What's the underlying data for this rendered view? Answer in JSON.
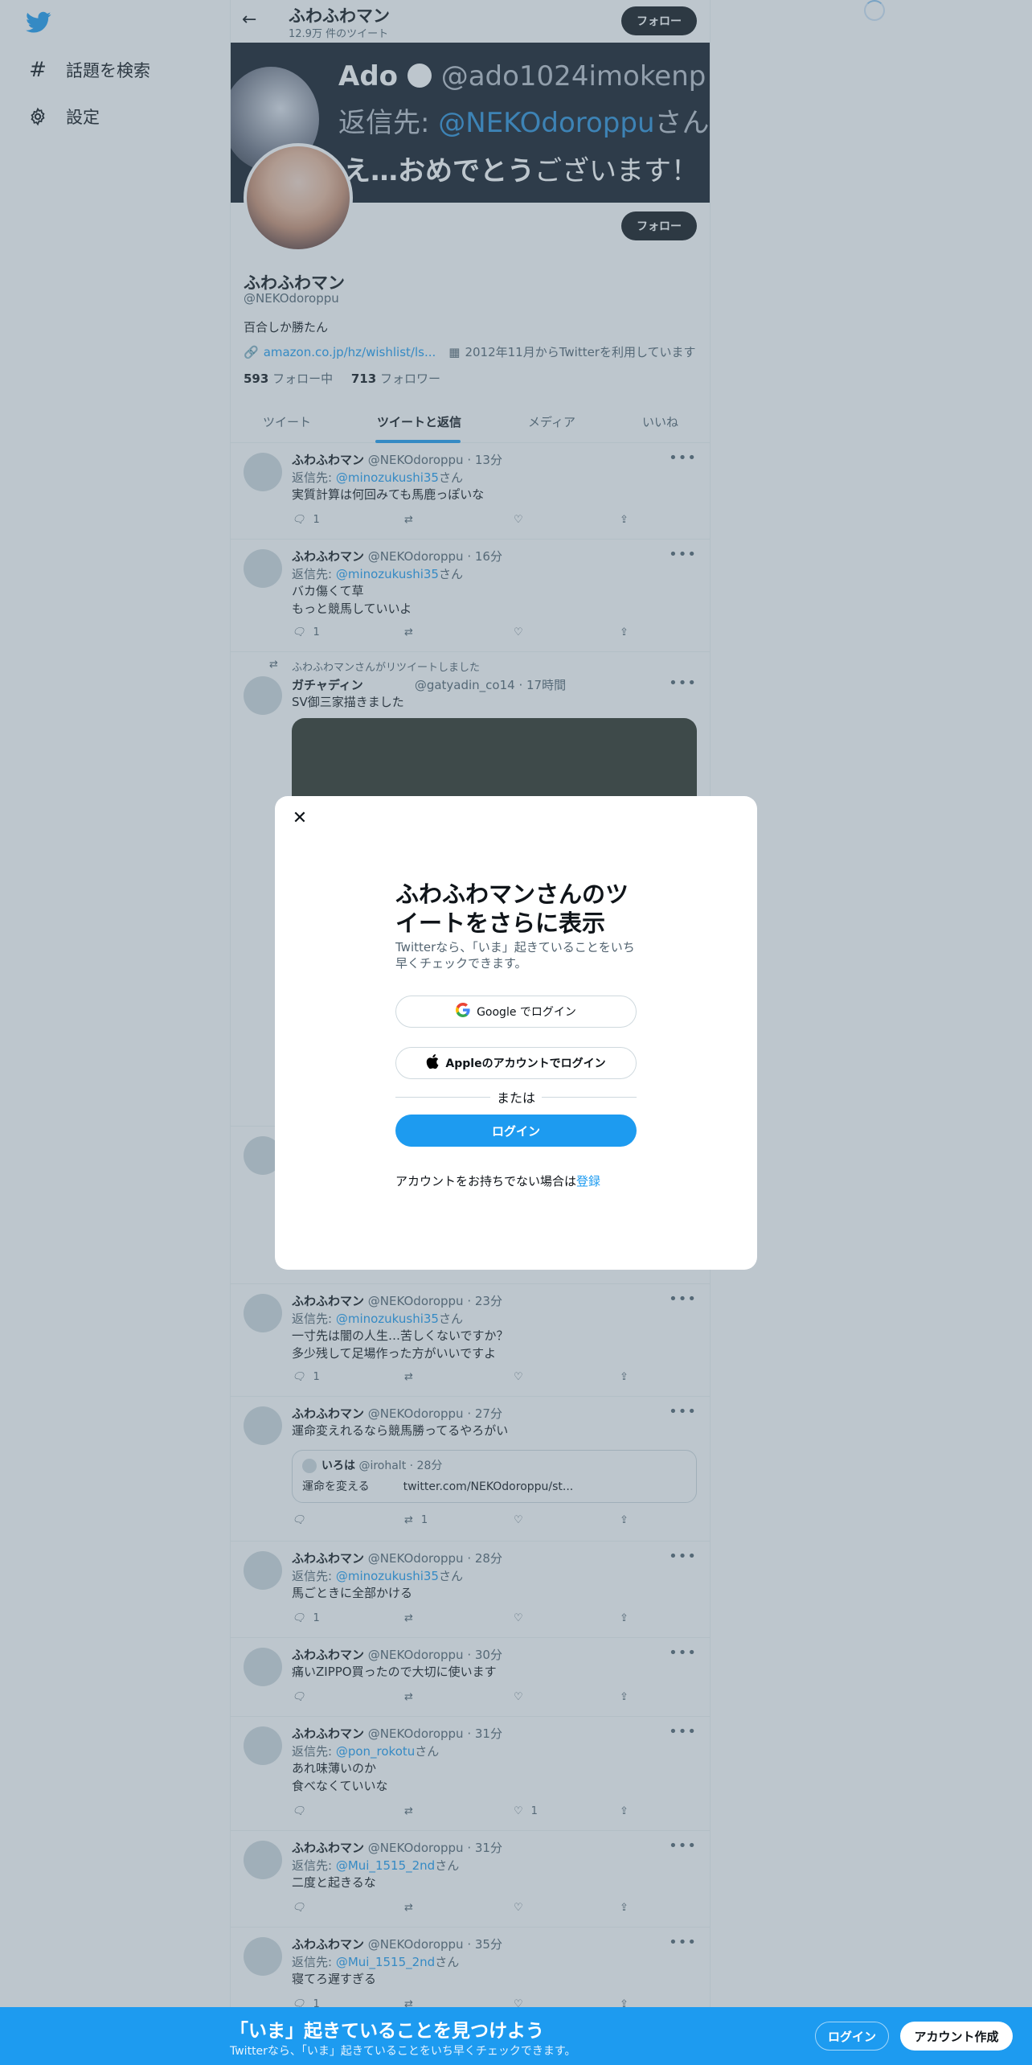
{
  "sidebar": {
    "items": [
      {
        "icon": "hashtag-icon",
        "label": "話題を検索"
      },
      {
        "icon": "gear-icon",
        "label": "設定"
      }
    ]
  },
  "header": {
    "name": "ふわふわマン",
    "tweet_count": "12.9万 件のツイート",
    "follow_label": "フォロー"
  },
  "banner": {
    "name": "Ado",
    "handle": "@ado1024imokenp",
    "reply_prefix": "返信先: ",
    "reply_mention": "@NEKOdoroppu",
    "reply_suffix": "さん",
    "text_main": "え…おめでとう",
    "text_rest": "ございます！"
  },
  "profile": {
    "name": "ふわふわマン",
    "handle": "@NEKOdoroppu",
    "bio": "百合しか勝たん",
    "link": "amazon.co.jp/hz/wishlist/ls...",
    "joined": "2012年11月からTwitterを利用しています",
    "following_count": "593",
    "following_label": " フォロー中",
    "followers_count": "713",
    "followers_label": " フォロワー",
    "follow_label": "フォロー"
  },
  "tabs": [
    "ツイート",
    "ツイートと返信",
    "メディア",
    "いいね"
  ],
  "tweets": [
    {
      "name": "ふわふわマン",
      "meta": " @NEKOdoroppu · 13分",
      "reply_to": "@minozukushi35",
      "lines": [
        "実質計算は何回みても馬鹿っぽいな"
      ],
      "reply_count": "1",
      "rt_count": "",
      "like_count": ""
    },
    {
      "name": "ふわふわマン",
      "meta": " @NEKOdoroppu · 16分",
      "reply_to": "@minozukushi35",
      "lines": [
        "バカ傷くて草",
        "もっと競馬していいよ"
      ],
      "reply_count": "1",
      "rt_count": "",
      "like_count": ""
    },
    {
      "retweet_label": "ふわふわマンさんがリツイートしました",
      "name": "ガチャディン",
      "meta": "@gatyadin_co14 · 17時間",
      "lines": [
        "SV御三家描きました"
      ]
    },
    {
      "name": "ふわふわマン",
      "meta": " @NEKOdoroppu · 23分",
      "reply_to": "@minozukushi35",
      "lines": [
        "一寸先は闇の人生…苦しくないですか？",
        "多少残して足場作った方がいいですよ"
      ],
      "reply_count": "1",
      "rt_count": "",
      "like_count": ""
    },
    {
      "name": "ふわふわマン",
      "meta": " @NEKOdoroppu · 27分",
      "lines": [
        "運命変えれるなら競馬勝ってるやろがい"
      ],
      "quote": {
        "name": "いろは",
        "meta": " @irohalt · 28分",
        "text": "運命を変える　　　twitter.com/NEKOdoroppu/st..."
      },
      "reply_count": "",
      "rt_count": "1",
      "like_count": ""
    },
    {
      "name": "ふわふわマン",
      "meta": " @NEKOdoroppu · 28分",
      "reply_to": "@minozukushi35",
      "lines": [
        "馬ごときに全部かける"
      ],
      "reply_count": "1",
      "rt_count": "",
      "like_count": ""
    },
    {
      "name": "ふわふわマン",
      "meta": " @NEKOdoroppu · 30分",
      "lines": [
        "痛いZIPPO買ったので大切に使います"
      ],
      "reply_count": "",
      "rt_count": "",
      "like_count": ""
    },
    {
      "name": "ふわふわマン",
      "meta": " @NEKOdoroppu · 31分",
      "reply_to": "@pon_rokotu",
      "lines": [
        "あれ味薄いのか",
        "食べなくていいな"
      ],
      "reply_count": "",
      "rt_count": "",
      "like_count": "1"
    },
    {
      "name": "ふわふわマン",
      "meta": " @NEKOdoroppu · 31分",
      "reply_to": "@Mui_1515_2nd",
      "lines": [
        "二度と起きるな"
      ],
      "reply_count": "",
      "rt_count": "",
      "like_count": ""
    },
    {
      "name": "ふわふわマン",
      "meta": " @NEKOdoroppu · 35分",
      "reply_to": "@Mui_1515_2nd",
      "lines": [
        "寝てろ遅すぎる"
      ],
      "reply_count": "1",
      "rt_count": "",
      "like_count": ""
    }
  ],
  "reply_prefix": "返信先: ",
  "reply_suffix": "さん",
  "modal": {
    "title": "ふわふわマンさんのツイートをさらに表示",
    "subtitle": "Twitterなら、「いま」起きていることをいち早くチェックできます。",
    "google_label": "Google でログイン",
    "apple_label": "Appleのアカウントでログイン",
    "or_label": "または",
    "login_label": "ログイン",
    "no_account": "アカウントをお持ちでない場合は",
    "signup_link": "登録"
  },
  "bottom_bar": {
    "title": "「いま」起きていることを見つけよう",
    "subtitle": "Twitterなら、「いま」起きていることをいち早くチェックできます。",
    "login_label": "ログイン",
    "signup_label": "アカウント作成"
  },
  "colors": {
    "accent": "#1d9bf0",
    "text": "#0f1419",
    "muted": "#536471"
  }
}
